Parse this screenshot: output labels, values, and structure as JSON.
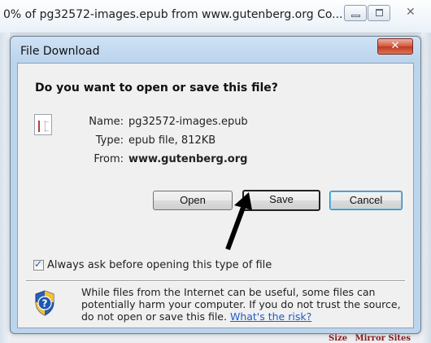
{
  "progress_window": {
    "title": "0% of pg32572-images.epub from www.gutenberg.org Co...",
    "close_glyph": "✕",
    "bottom_text": [
      "Size",
      "Mirror Sites"
    ]
  },
  "dialog": {
    "title": "File Download",
    "close_glyph": "✕",
    "question": "Do you want to open or save this file?",
    "fields": {
      "name_label": "Name:",
      "name_value": "pg32572-images.epub",
      "type_label": "Type:",
      "type_value": "epub file, 812KB",
      "from_label": "From:",
      "from_value": "www.gutenberg.org"
    },
    "buttons": {
      "open": "Open",
      "save": "Save",
      "cancel": "Cancel"
    },
    "checkbox": {
      "checked": true,
      "check_glyph": "✓",
      "label": "Always ask before opening this type of file"
    },
    "info": {
      "text": "While files from the Internet can be useful, some files can potentially harm your computer. If you do not trust the source, do not open or save this file.",
      "link": "What's the risk?"
    }
  },
  "icons": {
    "file": "epub-file-icon",
    "shield": "security-shield-icon",
    "arrow": "pointer-arrow-icon"
  },
  "colors": {
    "dialog_frame": "#bcd4ec",
    "close_red": "#c03a1e",
    "link_blue": "#1f5cc7",
    "shield_blue": "#2b5fb3",
    "shield_yellow": "#f2c230",
    "focus_blue": "#3c7fb1"
  }
}
